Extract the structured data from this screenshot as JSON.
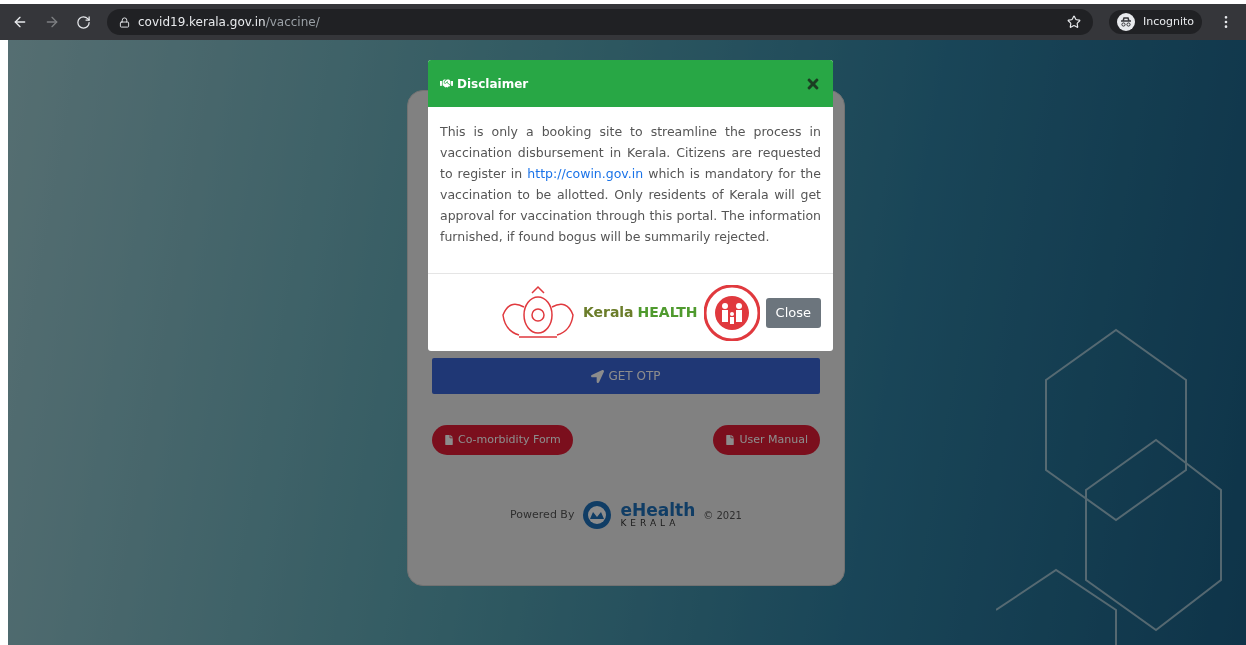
{
  "browser": {
    "url_host": "covid19.kerala.gov.in",
    "url_path": "/vaccine/",
    "profile": "Incognito"
  },
  "page": {
    "get_otp_button": "GET OTP",
    "links": [
      {
        "label": "Co-morbidity Form"
      },
      {
        "label": "User Manual"
      }
    ],
    "powered_by": "Powered By",
    "logo": {
      "title": "eHealth",
      "subtitle": "KERALA"
    },
    "copyright": "© 2021"
  },
  "dialog": {
    "title": "Disclaimer",
    "body_before": "This is only a booking site to streamline the process in vaccination disbursement in Kerala. Citizens are requested to register in",
    "body_link": "http://cowin.gov.in",
    "body_after": "which is mandatory for the vaccination to be allotted. Only residents of Kerala will get approval for vaccination through this portal. The information furnished, if found bogus will be summarily rejected.",
    "logo_text_1": "Kerala",
    "logo_text_2": "HEALTH",
    "close_button": "Close"
  }
}
